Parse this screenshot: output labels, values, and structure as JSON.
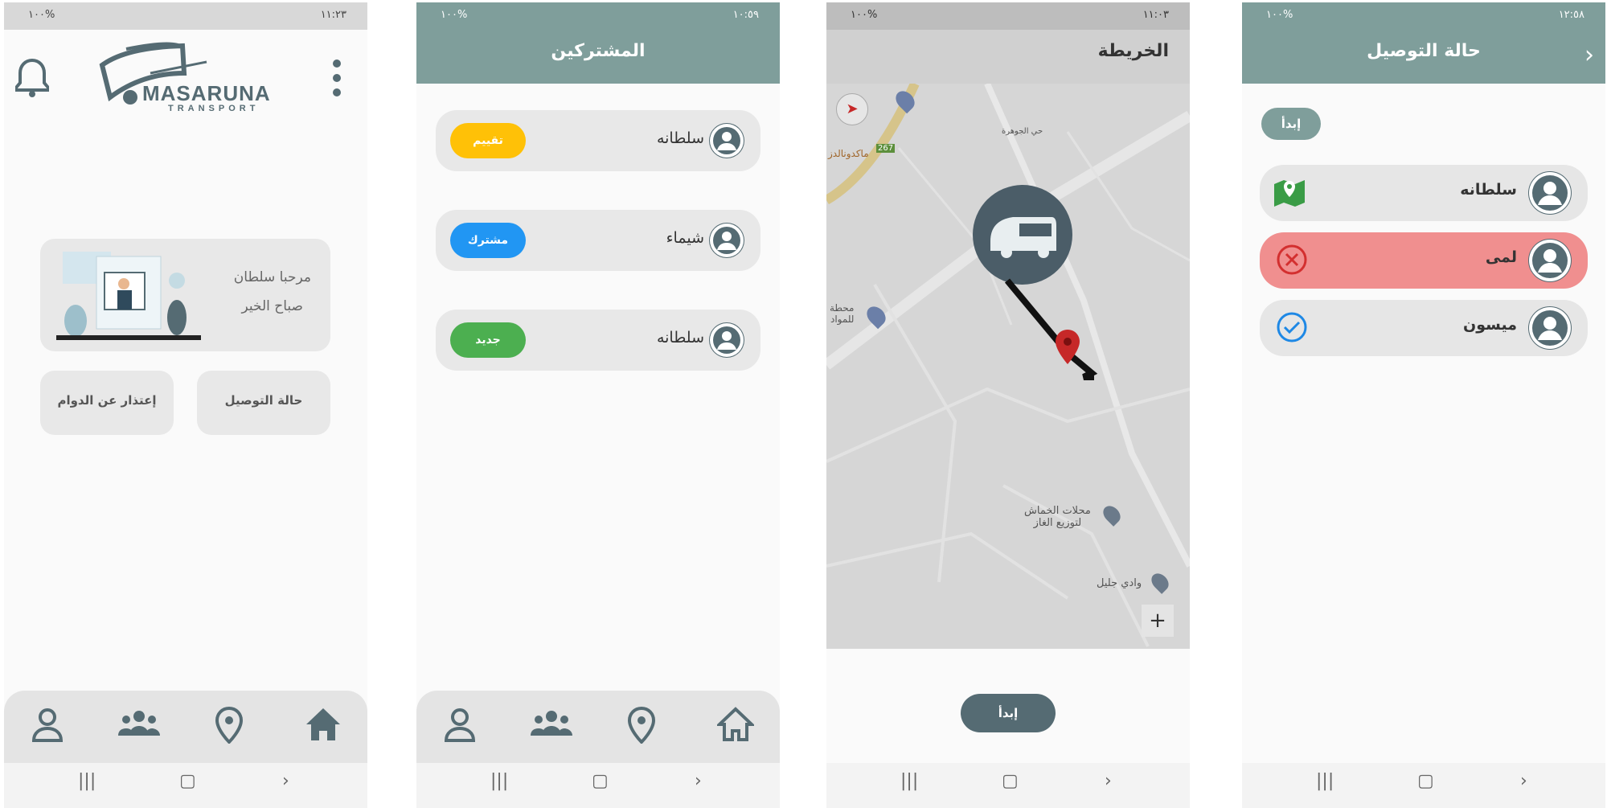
{
  "colors": {
    "accent": "#7f9e9b",
    "dark": "#556b73",
    "yellow": "#ffc107",
    "blue": "#2196f3",
    "green": "#4caf50",
    "red": "#f08f8f"
  },
  "screen1": {
    "status_time": "١١:٢٣",
    "status_battery": "١٠٠%",
    "logo_text": "MASARUNA",
    "logo_sub": "TRANSPORT",
    "greeting_line1": "مرحبا سلطان",
    "greeting_line2": "صباح الخير",
    "btn_delivery_status": "حالة التوصيل",
    "btn_excuse": "إعتذار عن الدوام"
  },
  "screen2": {
    "status_time": "١٠:٥٩",
    "status_battery": "١٠٠%",
    "title": "المشتركين",
    "subscribers": [
      {
        "name": "سلطانه",
        "badge": "تقييم"
      },
      {
        "name": "شيماء",
        "badge": "مشترك"
      },
      {
        "name": "سلطانه",
        "badge": "جديد"
      }
    ]
  },
  "screen3": {
    "status_time": "١١:٠٣",
    "status_battery": "١٠٠%",
    "title": "الخريطة",
    "map_labels": {
      "district": "حي الجوهرة",
      "mcdonalds": "ماكدونالدز",
      "road_number": "267",
      "station_line1": "محطة",
      "station_line2": "للمواد",
      "gas_line1": "محلات الخماش",
      "gas_line2": "لتوزيع الغاز",
      "valley": "وادي جليل"
    },
    "zoom_in": "+",
    "start_button": "إبدأ"
  },
  "screen4": {
    "status_time": "١٢:٥٨",
    "status_battery": "١٠٠%",
    "title": "حالة التوصيل",
    "start_button": "إبدأ",
    "passengers": [
      {
        "name": "سلطانه",
        "state": "map"
      },
      {
        "name": "لمى",
        "state": "absent"
      },
      {
        "name": "ميسون",
        "state": "done"
      }
    ]
  },
  "icons": {
    "bell": "bell-icon",
    "menu": "more-vert-icon",
    "person": "person-icon",
    "group": "group-icon",
    "location": "location-pin-icon",
    "home": "home-icon"
  }
}
